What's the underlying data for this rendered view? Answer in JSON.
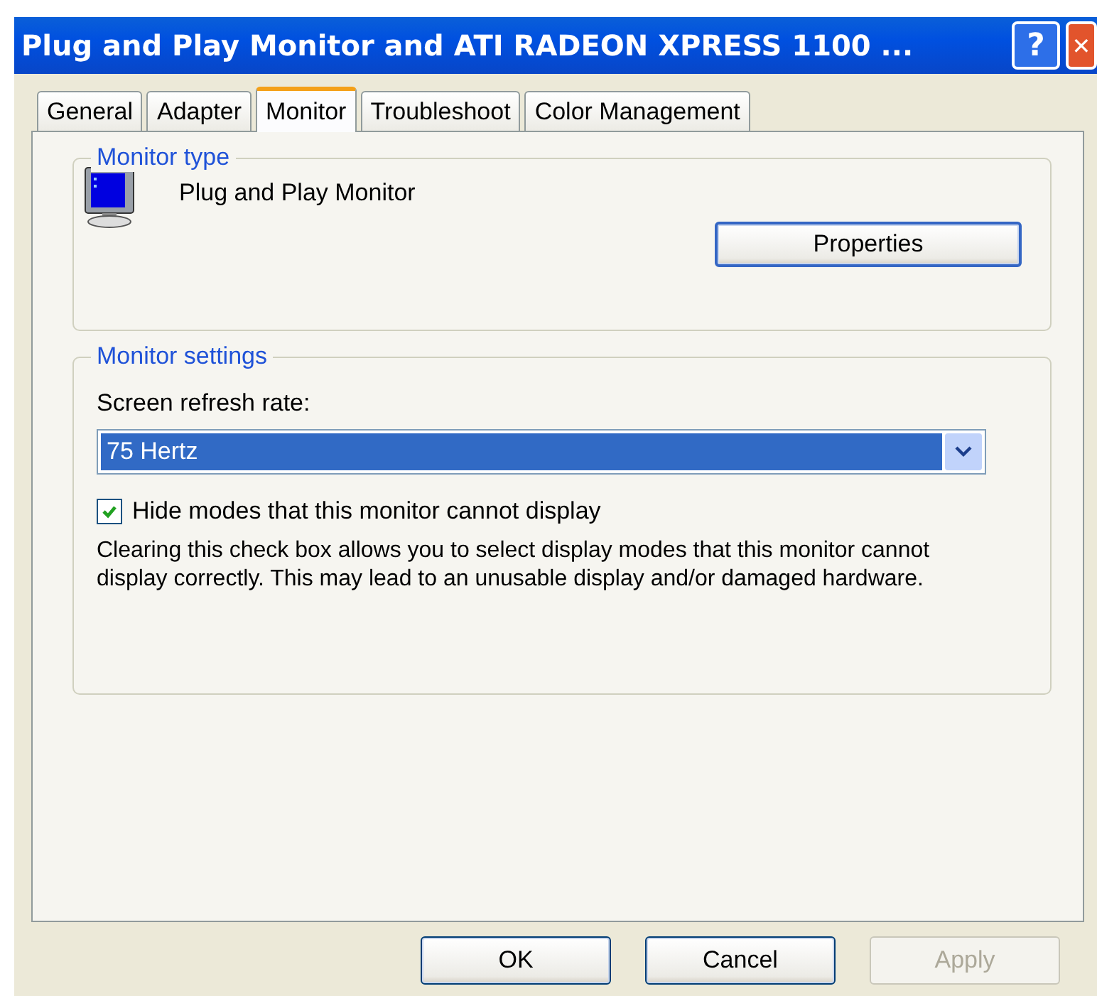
{
  "window": {
    "title": "Plug and Play Monitor and ATI RADEON XPRESS 1100 ..."
  },
  "title_buttons": [
    {
      "kind": "help",
      "label": "?"
    },
    {
      "kind": "close",
      "label": "✕"
    }
  ],
  "tabs": [
    {
      "label": "General",
      "selected": false
    },
    {
      "label": "Adapter",
      "selected": false
    },
    {
      "label": "Monitor",
      "selected": true
    },
    {
      "label": "Troubleshoot",
      "selected": false
    },
    {
      "label": "Color Management",
      "selected": false
    }
  ],
  "monitor_type": {
    "legend": "Monitor type",
    "name": "Plug and Play Monitor",
    "button": "Properties"
  },
  "monitor_settings": {
    "legend": "Monitor settings",
    "refresh_label": "Screen refresh rate:",
    "refresh_value": "75 Hertz",
    "hide_modes": {
      "label": "Hide modes that this monitor cannot display",
      "checked": true
    },
    "note": "Clearing this check box allows you to select display modes that this monitor cannot display correctly. This may lead to an unusable display and/or damaged hardware."
  },
  "buttons": [
    {
      "label": "OK",
      "disabled": false
    },
    {
      "label": "Cancel",
      "disabled": false
    },
    {
      "label": "Apply",
      "disabled": true
    }
  ]
}
